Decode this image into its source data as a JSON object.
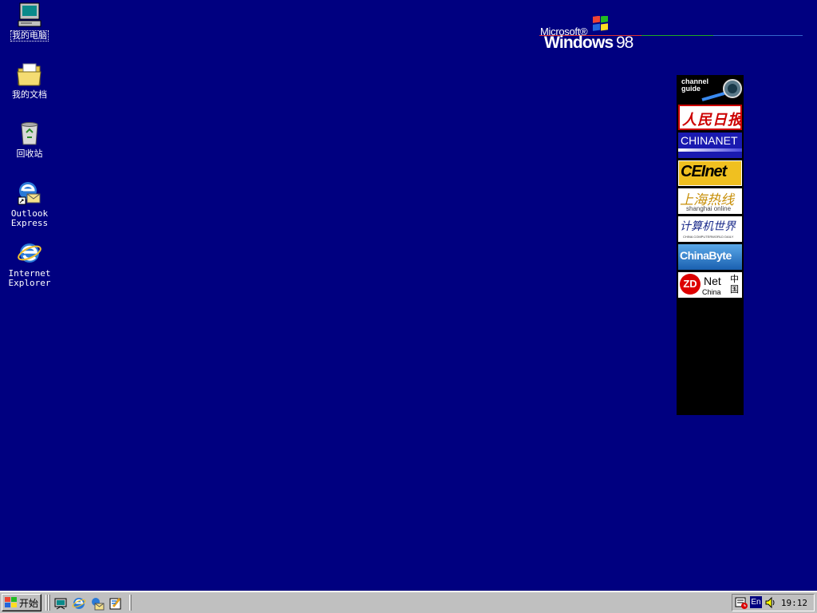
{
  "desktop": {
    "background_color": "#000080",
    "icons": [
      {
        "label": "我的电脑",
        "icon": "my-computer-icon"
      },
      {
        "label": "我的文档",
        "icon": "my-documents-icon"
      },
      {
        "label": "回收站",
        "icon": "recycle-bin-icon"
      },
      {
        "label": "Outlook\nExpress",
        "icon": "outlook-express-icon"
      },
      {
        "label": "Internet\nExplorer",
        "icon": "internet-explorer-icon"
      }
    ]
  },
  "logo": {
    "microsoft": "Microsoft®",
    "windows": "Windows",
    "version": "98"
  },
  "channel_bar": {
    "items": [
      {
        "line1": "channel",
        "line2": "guide"
      },
      {
        "label": "人民日报"
      },
      {
        "label": "CHINANET"
      },
      {
        "label": "CEInet"
      },
      {
        "label": "上海热线",
        "sub": "shanghai online"
      },
      {
        "label": "计算机世界",
        "sub": "CHINA COMPUTERWORLD DAILY"
      },
      {
        "label": "ChinaByte"
      },
      {
        "zd": "ZD",
        "net": "Net",
        "china": "China",
        "zh": "中国"
      }
    ]
  },
  "taskbar": {
    "start_label": "开始",
    "quick_launch": [
      "show-desktop-icon",
      "internet-explorer-icon",
      "outlook-express-icon",
      "channels-icon"
    ],
    "tray": {
      "language": "En",
      "clock": "19:12"
    }
  }
}
